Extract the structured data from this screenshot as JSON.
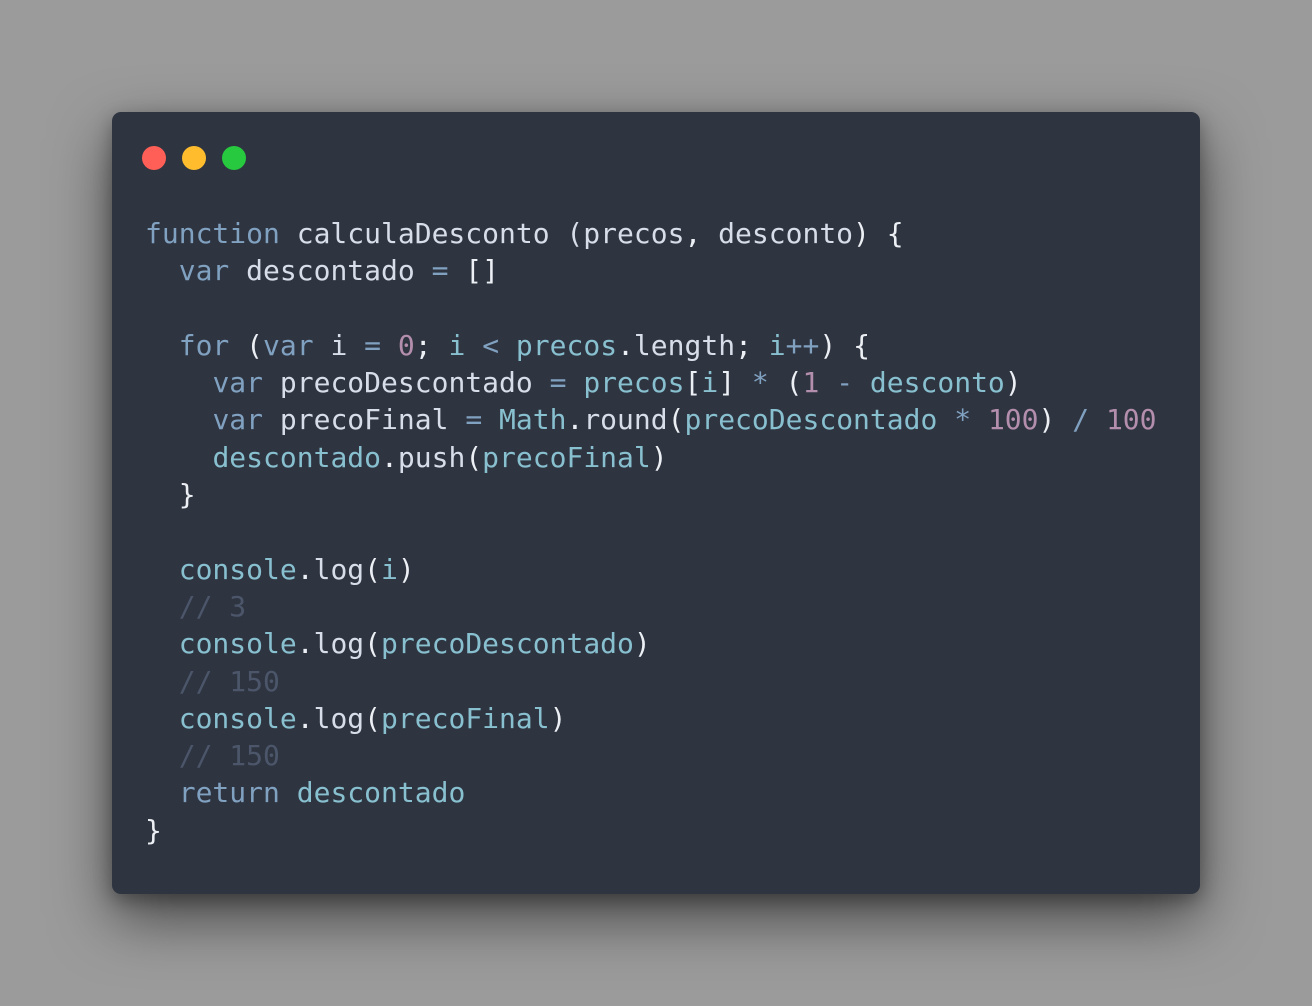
{
  "window": {
    "background": "#2e3440",
    "buttons": [
      {
        "name": "close-button",
        "color": "#ff5f56"
      },
      {
        "name": "minimize-button",
        "color": "#ffbd2e"
      },
      {
        "name": "maximize-button",
        "color": "#27c93f"
      }
    ]
  },
  "palette": {
    "keyword": "#81a1c1",
    "identifier": "#d8dee9",
    "variable": "#88c0d0",
    "operator": "#81a1c1",
    "number": "#b48ead",
    "punctuation": "#eceff4",
    "comment": "#4c566a"
  },
  "code": {
    "lines": [
      [
        [
          "keyword",
          "function"
        ],
        [
          "identifier",
          " calculaDesconto ("
        ],
        [
          "identifier",
          "precos"
        ],
        [
          "punctuation",
          ", "
        ],
        [
          "identifier",
          "desconto"
        ],
        [
          "punctuation",
          ") {"
        ]
      ],
      [
        [
          "identifier",
          "  "
        ],
        [
          "keyword",
          "var"
        ],
        [
          "identifier",
          " descontado "
        ],
        [
          "operator",
          "="
        ],
        [
          "punctuation",
          " []"
        ]
      ],
      [],
      [
        [
          "identifier",
          "  "
        ],
        [
          "keyword",
          "for"
        ],
        [
          "punctuation",
          " ("
        ],
        [
          "keyword",
          "var"
        ],
        [
          "identifier",
          " i "
        ],
        [
          "operator",
          "="
        ],
        [
          "identifier",
          " "
        ],
        [
          "number",
          "0"
        ],
        [
          "punctuation",
          "; "
        ],
        [
          "variable",
          "i"
        ],
        [
          "identifier",
          " "
        ],
        [
          "operator",
          "<"
        ],
        [
          "identifier",
          " "
        ],
        [
          "variable",
          "precos"
        ],
        [
          "punctuation",
          "."
        ],
        [
          "identifier",
          "length"
        ],
        [
          "punctuation",
          "; "
        ],
        [
          "variable",
          "i"
        ],
        [
          "operator",
          "++"
        ],
        [
          "punctuation",
          ") {"
        ]
      ],
      [
        [
          "identifier",
          "    "
        ],
        [
          "keyword",
          "var"
        ],
        [
          "identifier",
          " precoDescontado "
        ],
        [
          "operator",
          "="
        ],
        [
          "identifier",
          " "
        ],
        [
          "variable",
          "precos"
        ],
        [
          "punctuation",
          "["
        ],
        [
          "variable",
          "i"
        ],
        [
          "punctuation",
          "] "
        ],
        [
          "operator",
          "*"
        ],
        [
          "punctuation",
          " ("
        ],
        [
          "number",
          "1"
        ],
        [
          "identifier",
          " "
        ],
        [
          "operator",
          "-"
        ],
        [
          "identifier",
          " "
        ],
        [
          "variable",
          "desconto"
        ],
        [
          "punctuation",
          ")"
        ]
      ],
      [
        [
          "identifier",
          "    "
        ],
        [
          "keyword",
          "var"
        ],
        [
          "identifier",
          " precoFinal "
        ],
        [
          "operator",
          "="
        ],
        [
          "identifier",
          " "
        ],
        [
          "variable",
          "Math"
        ],
        [
          "punctuation",
          "."
        ],
        [
          "identifier",
          "round"
        ],
        [
          "punctuation",
          "("
        ],
        [
          "variable",
          "precoDescontado"
        ],
        [
          "identifier",
          " "
        ],
        [
          "operator",
          "*"
        ],
        [
          "identifier",
          " "
        ],
        [
          "number",
          "100"
        ],
        [
          "punctuation",
          ") "
        ],
        [
          "operator",
          "/"
        ],
        [
          "identifier",
          " "
        ],
        [
          "number",
          "100"
        ]
      ],
      [
        [
          "identifier",
          "    "
        ],
        [
          "variable",
          "descontado"
        ],
        [
          "punctuation",
          "."
        ],
        [
          "identifier",
          "push"
        ],
        [
          "punctuation",
          "("
        ],
        [
          "variable",
          "precoFinal"
        ],
        [
          "punctuation",
          ")"
        ]
      ],
      [
        [
          "punctuation",
          "  }"
        ]
      ],
      [],
      [
        [
          "identifier",
          "  "
        ],
        [
          "variable",
          "console"
        ],
        [
          "punctuation",
          "."
        ],
        [
          "identifier",
          "log"
        ],
        [
          "punctuation",
          "("
        ],
        [
          "variable",
          "i"
        ],
        [
          "punctuation",
          ")"
        ]
      ],
      [
        [
          "identifier",
          "  "
        ],
        [
          "comment",
          "// 3"
        ]
      ],
      [
        [
          "identifier",
          "  "
        ],
        [
          "variable",
          "console"
        ],
        [
          "punctuation",
          "."
        ],
        [
          "identifier",
          "log"
        ],
        [
          "punctuation",
          "("
        ],
        [
          "variable",
          "precoDescontado"
        ],
        [
          "punctuation",
          ")"
        ]
      ],
      [
        [
          "identifier",
          "  "
        ],
        [
          "comment",
          "// 150"
        ]
      ],
      [
        [
          "identifier",
          "  "
        ],
        [
          "variable",
          "console"
        ],
        [
          "punctuation",
          "."
        ],
        [
          "identifier",
          "log"
        ],
        [
          "punctuation",
          "("
        ],
        [
          "variable",
          "precoFinal"
        ],
        [
          "punctuation",
          ")"
        ]
      ],
      [
        [
          "identifier",
          "  "
        ],
        [
          "comment",
          "// 150"
        ]
      ],
      [
        [
          "identifier",
          "  "
        ],
        [
          "keyword",
          "return"
        ],
        [
          "identifier",
          " "
        ],
        [
          "variable",
          "descontado"
        ]
      ],
      [
        [
          "punctuation",
          "}"
        ]
      ]
    ]
  }
}
